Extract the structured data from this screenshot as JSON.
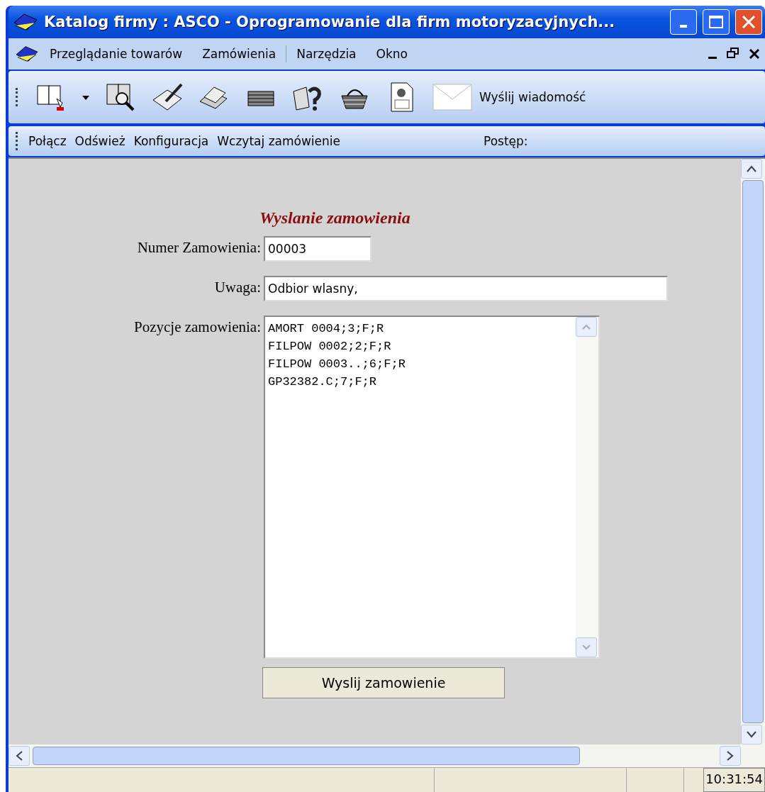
{
  "window": {
    "title": "Katalog firmy : ASCO - Oprogramowanie dla firm motoryzacyjnych..."
  },
  "menu": [
    "Przeglądanie towarów",
    "Zamówienia",
    "Narzędzia",
    "Okno"
  ],
  "toolbar": {
    "send_message": "Wyślij wiadomość"
  },
  "toolbar2": {
    "items": [
      "Połącz",
      "Odśwież",
      "Konfiguracja",
      "Wczytaj zamówienie"
    ],
    "progress_label": "Postęp:"
  },
  "form": {
    "title": "Wyslanie zamowienia",
    "fields": [
      {
        "kind": "short_input",
        "label": "Numer Zamowienia:",
        "value": "00003"
      },
      {
        "kind": "long_input",
        "label": "Uwaga:",
        "value": "Odbior wlasny,"
      },
      {
        "kind": "textarea",
        "label": "Pozycje zamowienia:",
        "lines": [
          "AMORT 0004;3;F;R",
          "FILPOW 0002;2;F;R",
          "FILPOW 0003..;6;F;R",
          "GP32382.C;7;F;R"
        ]
      }
    ],
    "submit": "Wyslij zamowienie"
  },
  "status_bar": {
    "time": "10:31:54"
  }
}
